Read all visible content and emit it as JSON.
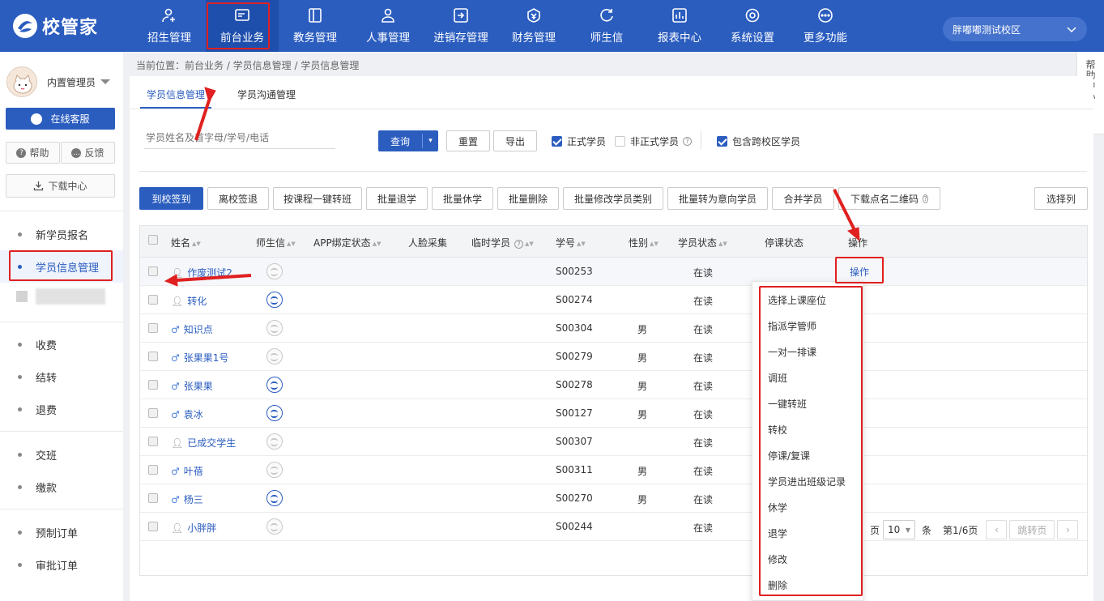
{
  "app": {
    "logo_text": "校管家"
  },
  "nav": [
    {
      "label": "招生管理",
      "icon": "person-add-icon"
    },
    {
      "label": "前台业务",
      "icon": "desk-icon",
      "active": true
    },
    {
      "label": "教务管理",
      "icon": "book-icon"
    },
    {
      "label": "人事管理",
      "icon": "person-icon"
    },
    {
      "label": "进销存管理",
      "icon": "inventory-icon"
    },
    {
      "label": "财务管理",
      "icon": "finance-icon"
    },
    {
      "label": "师生信",
      "icon": "message-icon"
    },
    {
      "label": "报表中心",
      "icon": "report-icon"
    },
    {
      "label": "系统设置",
      "icon": "gear-icon"
    },
    {
      "label": "更多功能",
      "icon": "more-icon"
    }
  ],
  "campus": {
    "label": "胖嘟嘟测试校区"
  },
  "sidebar": {
    "user_name": "内置管理员",
    "service_label": "在线客服",
    "help_label": "帮助",
    "feedback_label": "反馈",
    "download_label": "下载中心",
    "items": [
      {
        "label": "新学员报名"
      },
      {
        "label": "学员信息管理",
        "active": true
      },
      {
        "label": "收费"
      },
      {
        "label": "结转"
      },
      {
        "label": "退费"
      },
      {
        "label": "交班"
      },
      {
        "label": "缴款"
      },
      {
        "label": "预制订单"
      },
      {
        "label": "审批订单"
      }
    ]
  },
  "help_tab": {
    "chars": [
      "帮",
      "助",
      "中",
      "心"
    ],
    "collapse": "«"
  },
  "breadcrumb": "当前位置：前台业务 / 学员信息管理 / 学员信息管理",
  "tabs": [
    {
      "label": "学员信息管理",
      "active": true
    },
    {
      "label": "学员沟通管理"
    }
  ],
  "search": {
    "placeholder": "学员姓名及首字母/学号/电话",
    "query_label": "查询",
    "reset_label": "重置",
    "export_label": "导出"
  },
  "filters": {
    "formal": "正式学员",
    "informal": "非正式学员",
    "cross_campus": "包含跨校区学员"
  },
  "actions": [
    "到校签到",
    "离校签退",
    "按课程一键转班",
    "批量退学",
    "批量休学",
    "批量删除",
    "批量修改学员类别",
    "批量转为意向学员",
    "合并学员",
    "下载点名二维码"
  ],
  "select_columns": "选择列",
  "table": {
    "headers": {
      "name": "姓名",
      "msg": "师生信",
      "app": "APP绑定状态",
      "face": "人脸采集",
      "temp": "临时学员",
      "no": "学号",
      "gender": "性别",
      "status": "学员状态",
      "suspend": "停课状态",
      "op": "操作"
    },
    "rows": [
      {
        "name": "作废测试2",
        "gender_icon": "neutral",
        "app": false,
        "no": "S00253",
        "gender": "",
        "status": "在读",
        "op": "操作"
      },
      {
        "name": "转化",
        "gender_icon": "neutral",
        "app": true,
        "no": "S00274",
        "gender": "",
        "status": "在读"
      },
      {
        "name": "知识点",
        "gender_icon": "male",
        "app": false,
        "no": "S00304",
        "gender": "男",
        "status": "在读"
      },
      {
        "name": "张果果1号",
        "gender_icon": "male",
        "app": false,
        "no": "S00279",
        "gender": "男",
        "status": "在读"
      },
      {
        "name": "张果果",
        "gender_icon": "male",
        "app": true,
        "no": "S00278",
        "gender": "男",
        "status": "在读"
      },
      {
        "name": "袁冰",
        "gender_icon": "male",
        "app": true,
        "no": "S00127",
        "gender": "男",
        "status": "在读"
      },
      {
        "name": "已成交学生",
        "gender_icon": "neutral",
        "app": false,
        "no": "S00307",
        "gender": "",
        "status": "在读"
      },
      {
        "name": "叶蓓",
        "gender_icon": "male",
        "app": false,
        "no": "S00311",
        "gender": "男",
        "status": "在读"
      },
      {
        "name": "杨三",
        "gender_icon": "male",
        "app": true,
        "no": "S00270",
        "gender": "男",
        "status": "在读"
      },
      {
        "name": "小胖胖",
        "gender_icon": "neutral",
        "app": false,
        "no": "S00244",
        "gender": "",
        "status": "在读"
      }
    ]
  },
  "pagination": {
    "page_size": "10",
    "unit": "条",
    "page_info": "第1/6页",
    "jump": "跳转页",
    "prefix": "页"
  },
  "op_menu": [
    "选择上课座位",
    "指派学管师",
    "一对一排课",
    "调班",
    "一键转班",
    "转校",
    "停课/复课",
    "学员进出班级记录",
    "休学",
    "退学",
    "修改",
    "删除"
  ],
  "colors": {
    "brand": "#2b5dbf",
    "annotation": "#e02020"
  }
}
